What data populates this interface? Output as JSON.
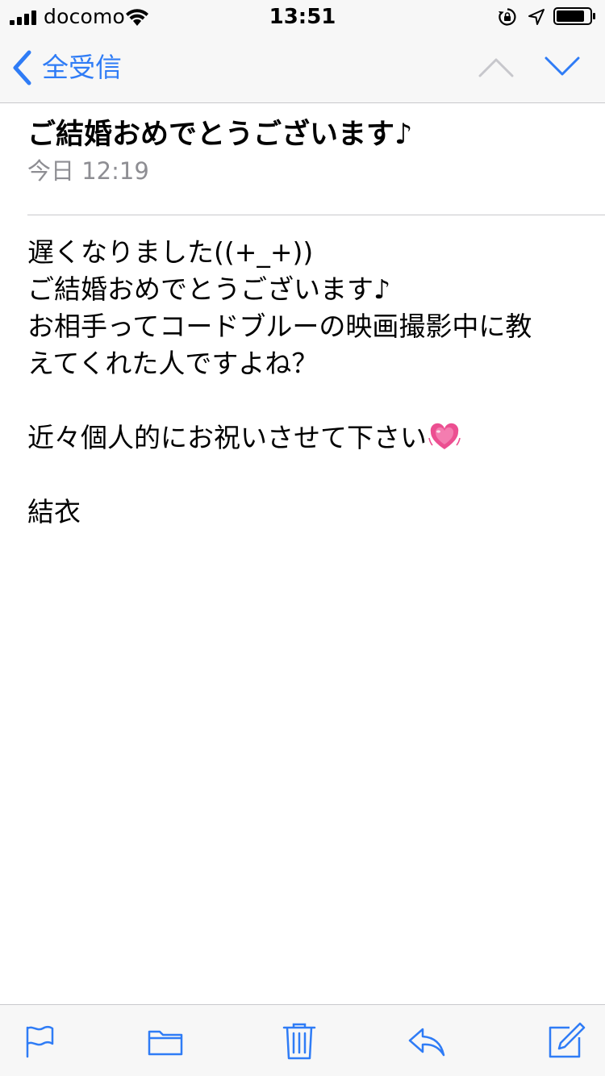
{
  "status_bar": {
    "carrier": "docomo",
    "time": "13:51",
    "signal_bars": 4,
    "battery_level": 0.85
  },
  "nav": {
    "back_label": "全受信",
    "icons": {
      "back": "chevron-left-icon",
      "previous": "chevron-up-icon",
      "next": "chevron-down-icon"
    },
    "accent_color": "#2f7cf6",
    "disabled_color": "#c7c7cc"
  },
  "message": {
    "subject": "ご結婚おめでとうございます♪",
    "date": "今日 12:19",
    "body_lines": [
      "遅くなりました((+_+))",
      "ご結婚おめでとうございます♪",
      "お相手ってコードブルーの映画撮影中に教",
      "えてくれた人ですよね？",
      "",
      "近々個人的にお祝いさせて下さい",
      "",
      "結衣"
    ],
    "emoji": "growing-heart-icon"
  },
  "toolbar": {
    "items": [
      "flag-icon",
      "folder-icon",
      "trash-icon",
      "reply-icon",
      "compose-icon"
    ]
  }
}
